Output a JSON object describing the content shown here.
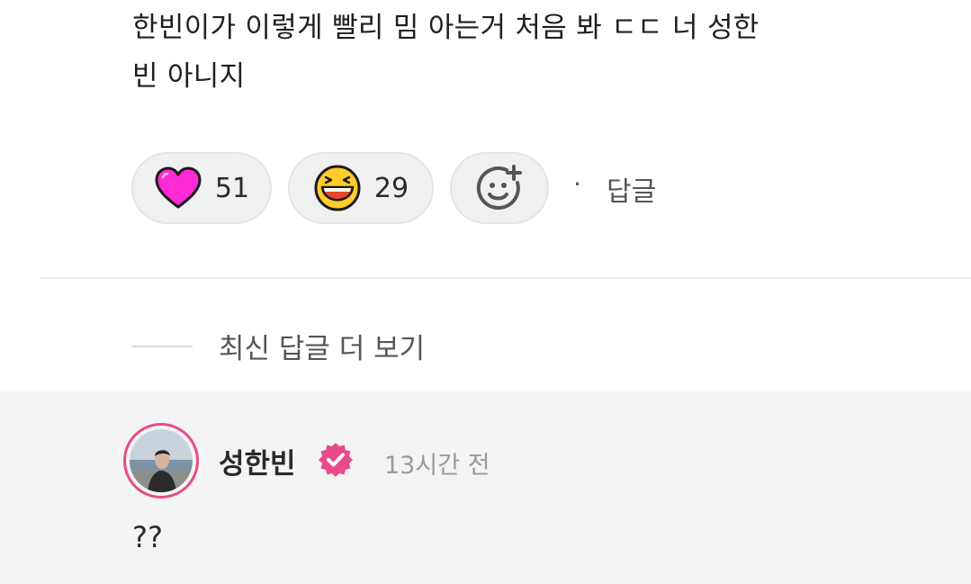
{
  "comment": {
    "text_line1": "한빈이가 이렇게 빨리 밈 아는거 처음 봐 ㄷㄷ 너 성한",
    "text_line2": "빈 아니지"
  },
  "reactions": [
    {
      "icon": "heart-icon",
      "count": "51",
      "color": "#ff2ad4"
    },
    {
      "icon": "laughing-face-icon",
      "count": "29",
      "color": "#ffcc2a"
    },
    {
      "icon": "add-reaction-icon"
    }
  ],
  "actions": {
    "separator": "·",
    "reply_label": "답글"
  },
  "more_replies": {
    "label": "최신 답글 더 보기"
  },
  "reply": {
    "author": "성한빈",
    "verified_color": "#e84b8a",
    "time": "13시간 전",
    "text": "??"
  }
}
